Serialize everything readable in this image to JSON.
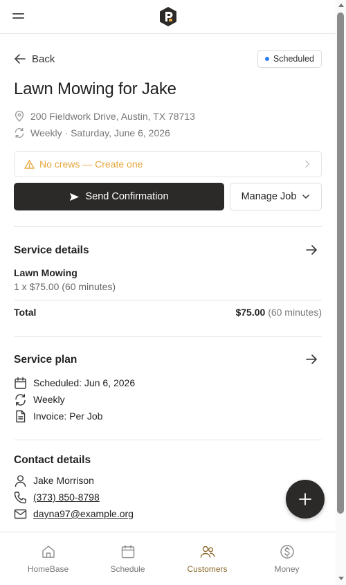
{
  "header": {
    "logo_icon": "brand-logo-icon",
    "menu_icon": "hamburger-icon"
  },
  "job": {
    "back_label": "Back",
    "status": "Scheduled",
    "status_color": "#2f7ef5",
    "title": "Lawn Mowing for Jake",
    "address": "200 Fieldwork Drive, Austin, TX 78713",
    "recurrence": "Weekly · Saturday, June 6, 2026"
  },
  "warning": {
    "text": "No crews — Create one",
    "color": "#e6a63a"
  },
  "actions": {
    "send_label": "Send Confirmation",
    "manage_label": "Manage Job"
  },
  "service_details": {
    "title": "Service details",
    "item_name": "Lawn Mowing",
    "item_detail": "1 x $75.00 (60 minutes)",
    "total_label": "Total",
    "total_amount": "$75.00",
    "total_duration": "(60 minutes)"
  },
  "service_plan": {
    "title": "Service plan",
    "scheduled": "Scheduled: Jun 6, 2026",
    "frequency": "Weekly",
    "invoice": "Invoice: Per Job"
  },
  "contact": {
    "title": "Contact details",
    "name": "Jake Morrison",
    "phone": "(373) 850-8798",
    "email": "dayna97@example.org"
  },
  "nav": {
    "items": [
      {
        "label": "HomeBase",
        "icon": "home-icon"
      },
      {
        "label": "Schedule",
        "icon": "calendar-icon"
      },
      {
        "label": "Customers",
        "icon": "customers-icon"
      },
      {
        "label": "Money",
        "icon": "dollar-icon"
      }
    ],
    "active": "Customers",
    "active_color": "#8a6a2a"
  }
}
